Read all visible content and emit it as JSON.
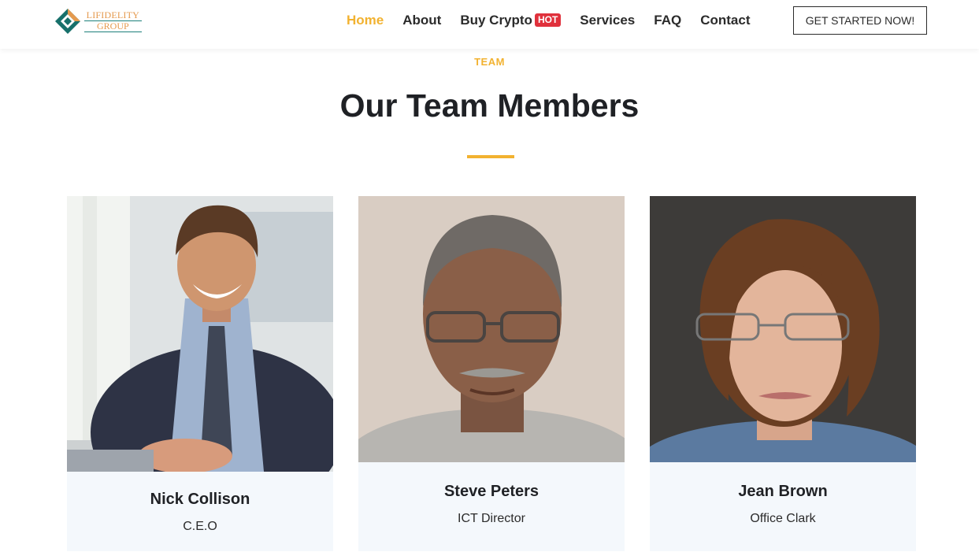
{
  "brand": {
    "line1": "LIFIDELITY",
    "line2": "GROUP"
  },
  "nav": {
    "items": [
      {
        "label": "Home",
        "active": true
      },
      {
        "label": "About"
      },
      {
        "label": "Buy Crypto",
        "badge": "HOT"
      },
      {
        "label": "Services"
      },
      {
        "label": "FAQ"
      },
      {
        "label": "Contact"
      }
    ],
    "cta_label": "GET STARTED NOW!"
  },
  "section": {
    "eyebrow": "TEAM",
    "title": "Our Team Members"
  },
  "team": [
    {
      "name": "Nick Collison",
      "role": "C.E.O"
    },
    {
      "name": "Steve Peters",
      "role": "ICT Director"
    },
    {
      "name": "Jean Brown",
      "role": "Office Clark"
    }
  ],
  "colors": {
    "accent": "#f2b230",
    "hot": "#e0313c",
    "card_bg": "#f4f8fc",
    "heading": "#1f2125"
  }
}
